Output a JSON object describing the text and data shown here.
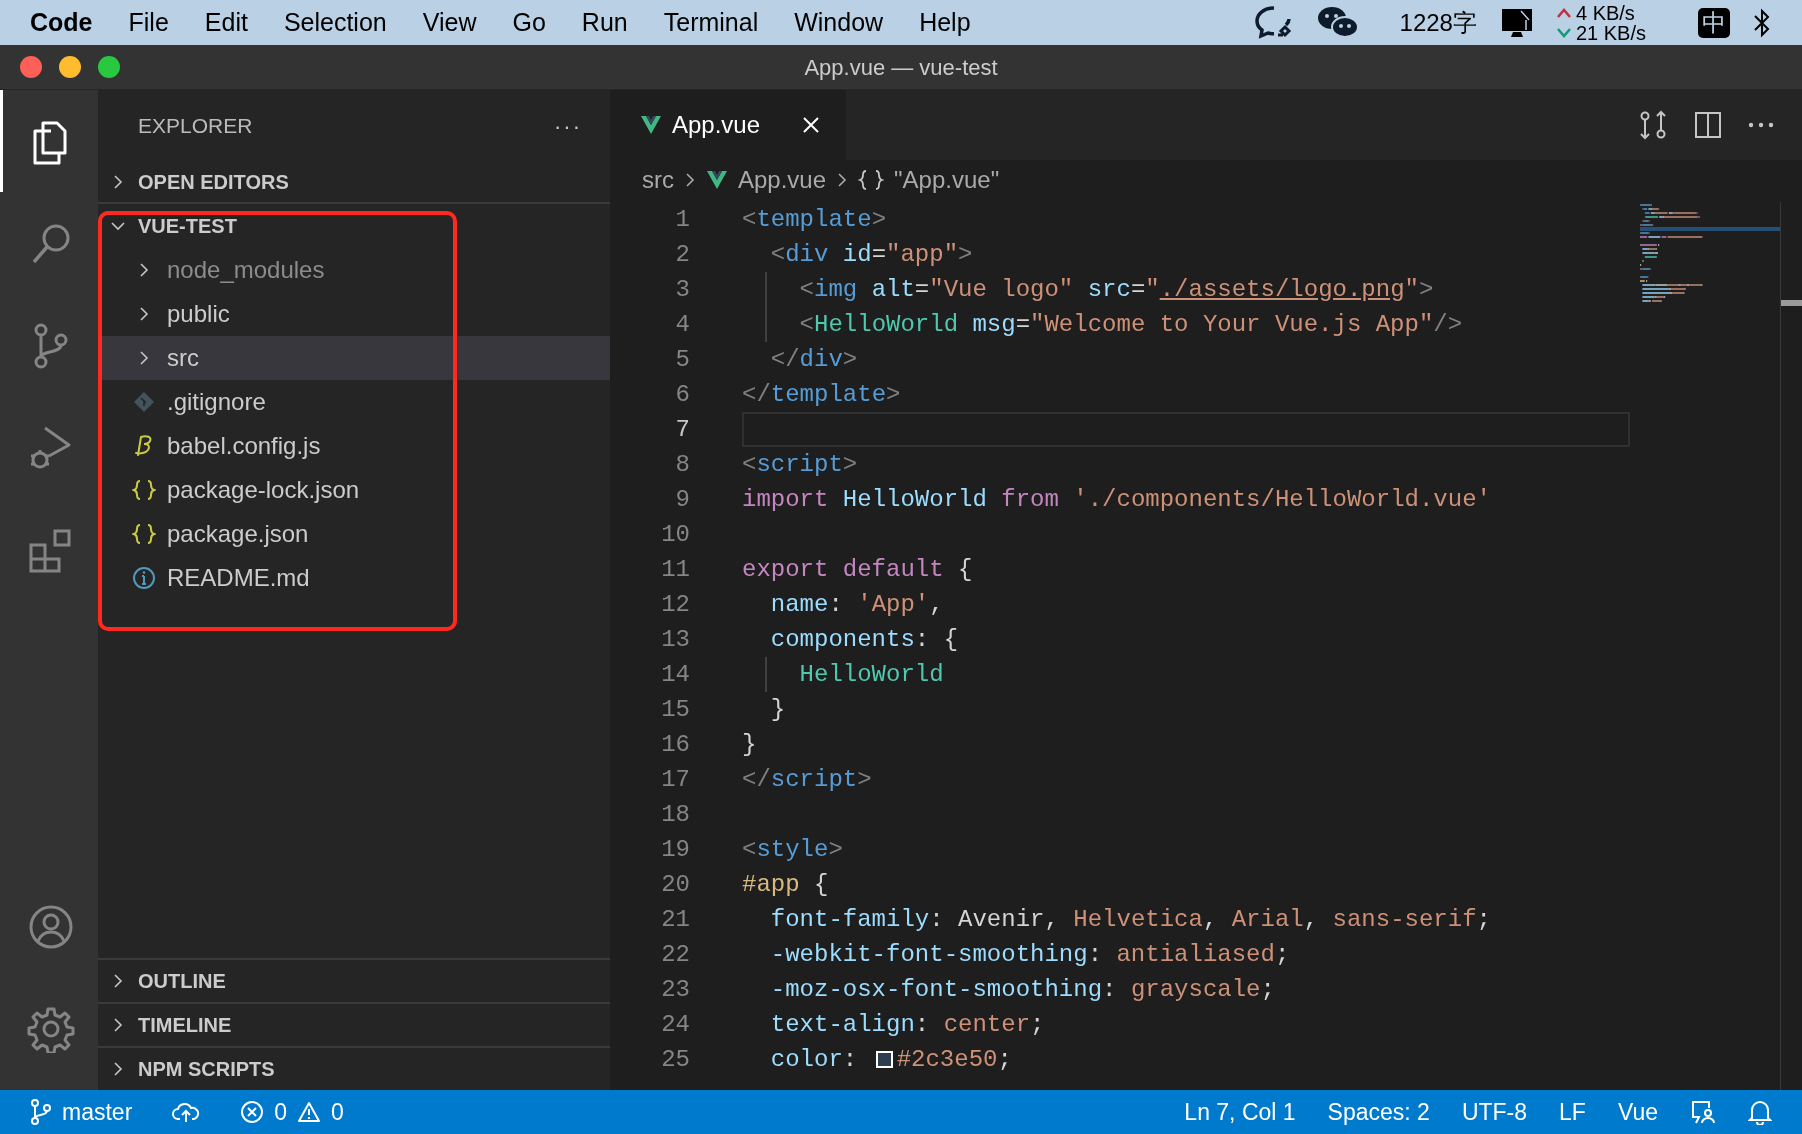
{
  "menu_bar": {
    "app": "Code",
    "items": [
      "File",
      "Edit",
      "Selection",
      "View",
      "Go",
      "Run",
      "Terminal",
      "Window",
      "Help"
    ],
    "word_count": "1228字",
    "upload_speed": "4 KB/s",
    "download_speed": "21 KB/s",
    "input_method": "中"
  },
  "window": {
    "title": "App.vue — vue-test"
  },
  "activity_bar": [
    {
      "kind": "files",
      "selected": true
    },
    {
      "kind": "search",
      "selected": false
    },
    {
      "kind": "source-control",
      "selected": false
    },
    {
      "kind": "run",
      "selected": false
    },
    {
      "kind": "extensions",
      "selected": false
    },
    {
      "kind": "account",
      "selected": false
    },
    {
      "kind": "settings",
      "selected": false
    }
  ],
  "sidebar": {
    "title": "EXPLORER",
    "more": "···",
    "sections": [
      {
        "label": "OPEN EDITORS",
        "expanded": false
      }
    ],
    "root": {
      "label": "VUE-TEST",
      "expanded": true,
      "children": [
        {
          "label": "node_modules",
          "kind": "folder",
          "expanded": false,
          "dimmed": true,
          "selected": false
        },
        {
          "label": "public",
          "kind": "folder",
          "expanded": false,
          "dimmed": false,
          "selected": false
        },
        {
          "label": "src",
          "kind": "folder",
          "expanded": false,
          "dimmed": false,
          "selected": true
        },
        {
          "label": ".gitignore",
          "kind": "git",
          "dimmed": false,
          "selected": false
        },
        {
          "label": "babel.config.js",
          "kind": "babel",
          "dimmed": false,
          "selected": false
        },
        {
          "label": "package-lock.json",
          "kind": "json",
          "dimmed": false,
          "selected": false
        },
        {
          "label": "package.json",
          "kind": "json",
          "dimmed": false,
          "selected": false
        },
        {
          "label": "README.md",
          "kind": "info",
          "dimmed": false,
          "selected": false
        }
      ]
    },
    "bottom_sections": [
      {
        "label": "OUTLINE",
        "expanded": false
      },
      {
        "label": "TIMELINE",
        "expanded": false
      },
      {
        "label": "NPM SCRIPTS",
        "expanded": false
      }
    ]
  },
  "tabs": [
    {
      "label": "App.vue",
      "selected": true
    }
  ],
  "breadcrumb": [
    "src",
    "App.vue",
    "\"App.vue\""
  ],
  "code_lines": [
    {
      "number": "1",
      "current": false,
      "tokens": [
        {
          "kind": "p",
          "text": "<"
        },
        {
          "kind": "tag",
          "text": "template"
        },
        {
          "kind": "p",
          "text": ">"
        }
      ]
    },
    {
      "number": "2",
      "current": false,
      "tokens": [
        {
          "kind": "p",
          "text": "  <"
        },
        {
          "kind": "tag",
          "text": "div"
        },
        {
          "kind": "attr",
          "text": " id"
        },
        {
          "kind": "txt",
          "text": "="
        },
        {
          "kind": "str",
          "text": "\"app\""
        },
        {
          "kind": "p",
          "text": ">"
        }
      ]
    },
    {
      "number": "3",
      "current": false,
      "tokens": [
        {
          "kind": "p",
          "text": "    <"
        },
        {
          "kind": "tag",
          "text": "img"
        },
        {
          "kind": "attr",
          "text": " alt"
        },
        {
          "kind": "txt",
          "text": "="
        },
        {
          "kind": "str",
          "text": "\"Vue logo\""
        },
        {
          "kind": "attr",
          "text": " src"
        },
        {
          "kind": "txt",
          "text": "="
        },
        {
          "kind": "str",
          "text": "\""
        },
        {
          "kind": "link",
          "text": "./assets/logo.png"
        },
        {
          "kind": "str",
          "text": "\""
        },
        {
          "kind": "p",
          "text": ">"
        }
      ]
    },
    {
      "number": "4",
      "current": false,
      "tokens": [
        {
          "kind": "p",
          "text": "    <"
        },
        {
          "kind": "ctag",
          "text": "HelloWorld"
        },
        {
          "kind": "attr",
          "text": " msg"
        },
        {
          "kind": "txt",
          "text": "="
        },
        {
          "kind": "str",
          "text": "\"Welcome to Your Vue.js App\""
        },
        {
          "kind": "p",
          "text": "/>"
        }
      ]
    },
    {
      "number": "5",
      "current": false,
      "tokens": [
        {
          "kind": "p",
          "text": "  </"
        },
        {
          "kind": "tag",
          "text": "div"
        },
        {
          "kind": "p",
          "text": ">"
        }
      ]
    },
    {
      "number": "6",
      "current": false,
      "tokens": [
        {
          "kind": "p",
          "text": "</"
        },
        {
          "kind": "tag",
          "text": "template"
        },
        {
          "kind": "p",
          "text": ">"
        }
      ]
    },
    {
      "number": "7",
      "current": true
    },
    {
      "number": "8",
      "current": false,
      "tokens": [
        {
          "kind": "p",
          "text": "<"
        },
        {
          "kind": "tag",
          "text": "script"
        },
        {
          "kind": "p",
          "text": ">"
        }
      ]
    },
    {
      "number": "9",
      "current": false,
      "tokens": [
        {
          "kind": "kw",
          "text": "import"
        },
        {
          "kind": "id",
          "text": " HelloWorld"
        },
        {
          "kind": "kw",
          "text": " from"
        },
        {
          "kind": "str",
          "text": " './components/HelloWorld.vue'"
        }
      ]
    },
    {
      "number": "10",
      "current": false
    },
    {
      "number": "11",
      "current": false,
      "tokens": [
        {
          "kind": "kw",
          "text": "export default"
        },
        {
          "kind": "txt",
          "text": " {"
        }
      ]
    },
    {
      "number": "12",
      "current": false,
      "tokens": [
        {
          "kind": "prop",
          "text": "  name"
        },
        {
          "kind": "txt",
          "text": ": "
        },
        {
          "kind": "str",
          "text": "'App'"
        },
        {
          "kind": "txt",
          "text": ","
        }
      ]
    },
    {
      "number": "13",
      "current": false,
      "tokens": [
        {
          "kind": "prop",
          "text": "  components"
        },
        {
          "kind": "txt",
          "text": ": {"
        }
      ]
    },
    {
      "number": "14",
      "current": false,
      "tokens": [
        {
          "kind": "cls",
          "text": "    HelloWorld"
        }
      ]
    },
    {
      "number": "15",
      "current": false,
      "tokens": [
        {
          "kind": "txt",
          "text": "  }"
        }
      ]
    },
    {
      "number": "16",
      "current": false,
      "tokens": [
        {
          "kind": "txt",
          "text": "}"
        }
      ]
    },
    {
      "number": "17",
      "current": false,
      "tokens": [
        {
          "kind": "p",
          "text": "</"
        },
        {
          "kind": "tag",
          "text": "script"
        },
        {
          "kind": "p",
          "text": ">"
        }
      ]
    },
    {
      "number": "18",
      "current": false
    },
    {
      "number": "19",
      "current": false,
      "tokens": [
        {
          "kind": "p",
          "text": "<"
        },
        {
          "kind": "tag",
          "text": "style"
        },
        {
          "kind": "p",
          "text": ">"
        }
      ]
    },
    {
      "number": "20",
      "current": false,
      "tokens": [
        {
          "kind": "sel",
          "text": "#app"
        },
        {
          "kind": "txt",
          "text": " {"
        }
      ]
    },
    {
      "number": "21",
      "current": false,
      "tokens": [
        {
          "kind": "prop",
          "text": "  font-family"
        },
        {
          "kind": "txt",
          "text": ": Avenir, "
        },
        {
          "kind": "val",
          "text": "Helvetica"
        },
        {
          "kind": "txt",
          "text": ", "
        },
        {
          "kind": "val",
          "text": "Arial"
        },
        {
          "kind": "txt",
          "text": ", "
        },
        {
          "kind": "val",
          "text": "sans-serif"
        },
        {
          "kind": "txt",
          "text": ";"
        }
      ]
    },
    {
      "number": "22",
      "current": false,
      "tokens": [
        {
          "kind": "prop",
          "text": "  -webkit-font-smoothing"
        },
        {
          "kind": "txt",
          "text": ": "
        },
        {
          "kind": "val",
          "text": "antialiased"
        },
        {
          "kind": "txt",
          "text": ";"
        }
      ]
    },
    {
      "number": "23",
      "current": false,
      "tokens": [
        {
          "kind": "prop",
          "text": "  -moz-osx-font-smoothing"
        },
        {
          "kind": "txt",
          "text": ": "
        },
        {
          "kind": "val",
          "text": "grayscale"
        },
        {
          "kind": "txt",
          "text": ";"
        }
      ]
    },
    {
      "number": "24",
      "current": false,
      "tokens": [
        {
          "kind": "prop",
          "text": "  text-align"
        },
        {
          "kind": "txt",
          "text": ": "
        },
        {
          "kind": "val",
          "text": "center"
        },
        {
          "kind": "txt",
          "text": ";"
        }
      ]
    },
    {
      "number": "25",
      "current": false,
      "tokens": [
        {
          "kind": "prop",
          "text": "  color"
        },
        {
          "kind": "txt",
          "text": ": "
        },
        {
          "kind": "swatch",
          "color": "#2c3e50"
        },
        {
          "kind": "val",
          "text": "#2c3e50"
        },
        {
          "kind": "txt",
          "text": ";"
        }
      ]
    }
  ],
  "status_bar": {
    "branch": "master",
    "errors": "0",
    "warnings": "0",
    "position": "Ln 7, Col 1",
    "spaces": "Spaces: 2",
    "encoding": "UTF-8",
    "eol": "LF",
    "language": "Vue"
  }
}
